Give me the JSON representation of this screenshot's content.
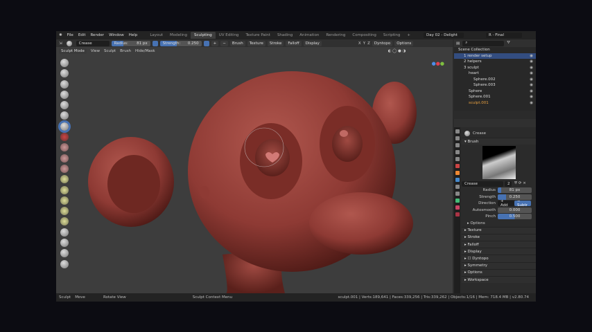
{
  "topbar": {
    "menus": [
      "File",
      "Edit",
      "Render",
      "Window",
      "Help"
    ],
    "workspaces": [
      "Layout",
      "Modeling",
      "Sculpting",
      "UV Editing",
      "Texture Paint",
      "Shading",
      "Animation",
      "Rendering",
      "Compositing",
      "Scripting"
    ],
    "active_workspace": "Sculpting",
    "scene": "Day 02 - Delight",
    "view_layer": "R - Final"
  },
  "tool_header": {
    "brush_name": "Crease",
    "radius_label": "Radius:",
    "radius_value": "81 px",
    "strength_label": "Strength:",
    "strength_value": "0.250",
    "dropdowns": [
      "Brush",
      "Texture",
      "Stroke",
      "Falloff",
      "Display"
    ],
    "symmetry": [
      "X",
      "Y",
      "Z"
    ],
    "dyntopo": "Dyntopo",
    "options": "Options"
  },
  "viewport_header": {
    "mode": "Sculpt Mode",
    "menus": [
      "View",
      "Sculpt",
      "Brush",
      "Hide/Mask"
    ]
  },
  "outliner": {
    "root": "Scene Collection",
    "items": [
      {
        "label": "1 render setup",
        "depth": 0,
        "selected": true
      },
      {
        "label": "2 helpers",
        "depth": 0
      },
      {
        "label": "3 sculpt",
        "depth": 0
      },
      {
        "label": "heart",
        "depth": 1
      },
      {
        "label": "Sphere.002",
        "depth": 2
      },
      {
        "label": "Sphere.003",
        "depth": 2
      },
      {
        "label": "Sphere",
        "depth": 1
      },
      {
        "label": "Sphere.001",
        "depth": 1
      },
      {
        "label": "sculpt.001",
        "depth": 1,
        "active": true
      }
    ]
  },
  "properties": {
    "brush_header": "Crease",
    "brush_panel": "Brush",
    "brush_field": "Crease",
    "users": "2",
    "rows": [
      {
        "label": "Radius",
        "value": "81 px",
        "fill": 0.1
      },
      {
        "label": "Strength",
        "value": "0.250",
        "fill": 0.25
      },
      {
        "label": "Autosmooth",
        "value": "0.000",
        "fill": 0
      },
      {
        "label": "Pinch",
        "value": "0.500",
        "fill": 0.5
      }
    ],
    "direction_label": "Direction",
    "direction_add": "+ Add",
    "direction_subtract": "− Subtr",
    "options_sub": "Options",
    "panels": [
      "Texture",
      "Stroke",
      "Falloff",
      "Display",
      "Dyntopo",
      "Symmetry",
      "Options",
      "Workspace"
    ]
  },
  "status": {
    "left": [
      "Sculpt",
      "Move",
      "Rotate View",
      "Sculpt Context Menu"
    ],
    "stats": "sculpt.001 | Verts:189,641 | Faces:339,256 | Tris:339,262 | Objects:1/16 | Mem: 718.4 MB | v2.80.74"
  },
  "colors": {
    "accent": "#4772b3",
    "sculpt": "#8e3a34",
    "background": "#3d3d3d"
  }
}
